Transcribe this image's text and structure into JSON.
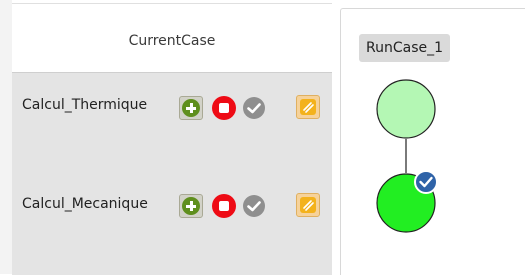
{
  "current_case": {
    "title": "CurrentCase",
    "rows": [
      {
        "label": "Calcul_Thermique"
      },
      {
        "label": "Calcul_Mecanique"
      }
    ]
  },
  "icons": {
    "add": "add-circle-icon",
    "stop": "stop-icon",
    "check": "check-icon",
    "note": "note-icon"
  },
  "run_case": {
    "tab_label": "RunCase_1",
    "nodes": [
      {
        "name": "Calcul_Thermique",
        "status": "pending",
        "color": "#b4f7b4"
      },
      {
        "name": "Calcul_Mecanique",
        "status": "done",
        "color": "#22ee22"
      }
    ]
  },
  "colors": {
    "panel_bg": "#e4e4e4",
    "add": "#5f8f1d",
    "stop": "#ee0b15",
    "check": "#8f8f8f",
    "note": "#f3b21c",
    "badge": "#2f63a8"
  }
}
